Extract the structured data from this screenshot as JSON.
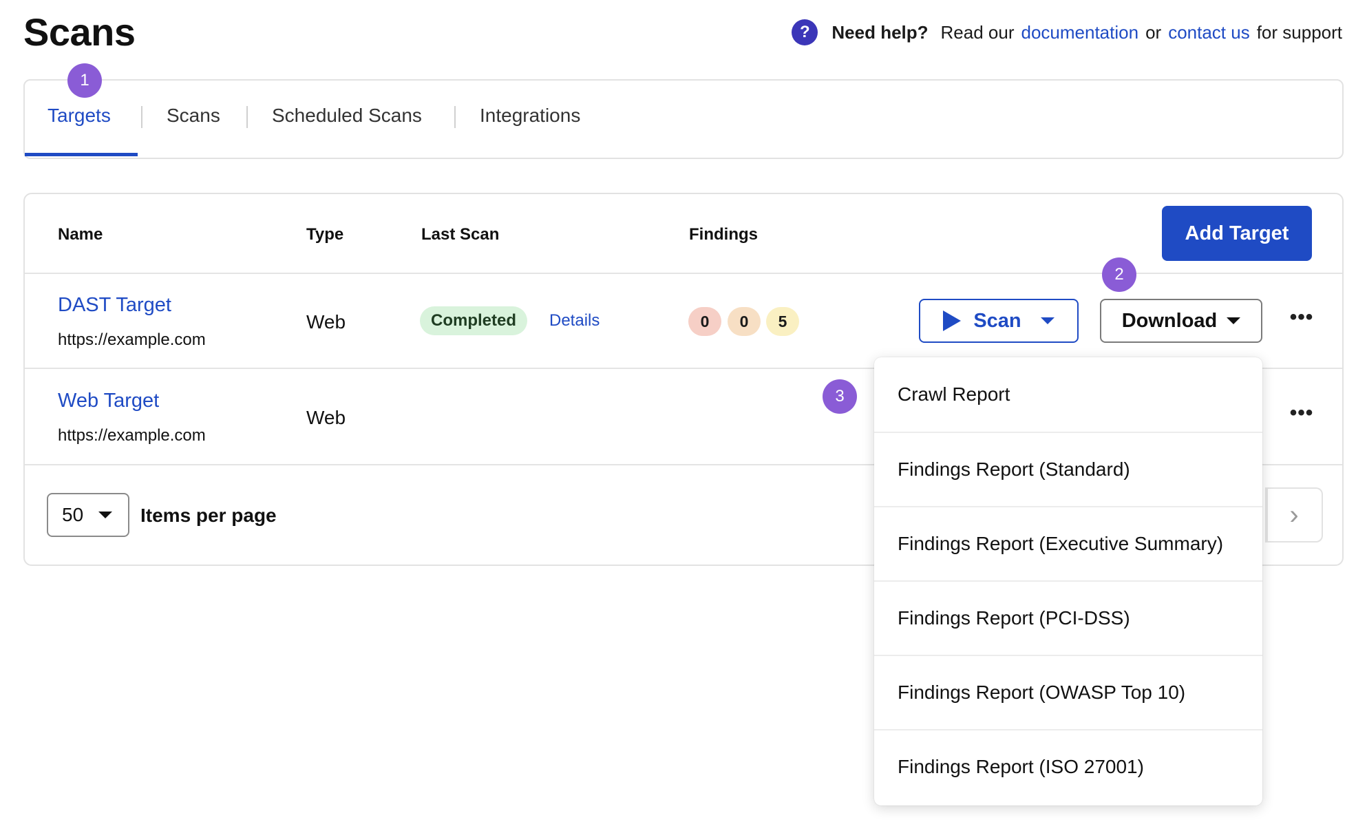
{
  "header": {
    "title": "Scans",
    "help_icon": "?",
    "help_strong": "Need help?",
    "help_text_1": "Read our",
    "help_link_docs": "documentation",
    "help_text_2": "or",
    "help_link_contact": "contact us",
    "help_text_3": "for support"
  },
  "tabs": [
    {
      "label": "Targets",
      "active": true
    },
    {
      "label": "Scans",
      "active": false
    },
    {
      "label": "Scheduled Scans",
      "active": false
    },
    {
      "label": "Integrations",
      "active": false
    }
  ],
  "steps": [
    "1",
    "2",
    "3"
  ],
  "table": {
    "columns": {
      "name": "Name",
      "type": "Type",
      "last_scan": "Last Scan",
      "findings": "Findings"
    },
    "add_button": "Add Target",
    "rows": [
      {
        "name": "DAST Target",
        "url": "https://example.com",
        "type": "Web",
        "status": "Completed",
        "details": "Details",
        "findings": [
          "0",
          "0",
          "5"
        ],
        "scan_button": "Scan",
        "download_button": "Download",
        "more": "•••"
      },
      {
        "name": "Web Target",
        "url": "https://example.com",
        "type": "Web",
        "more": "•••"
      }
    ]
  },
  "pagination": {
    "per_page_value": "50",
    "per_page_label": "Items per page",
    "next_icon": "›"
  },
  "download_menu": [
    "Crawl Report",
    "Findings Report (Standard)",
    "Findings Report (Executive Summary)",
    "Findings Report (PCI-DSS)",
    "Findings Report (OWASP Top 10)",
    "Findings Report (ISO 27001)"
  ],
  "colors": {
    "primary": "#1f4bc4",
    "step_badge": "#8a5cd6",
    "help_icon": "#3b36b8",
    "status_completed_bg": "#d9f3dc",
    "finding_critical_bg": "#f6cfc6",
    "finding_high_bg": "#f7dfc4",
    "finding_medium_bg": "#faf0c2"
  }
}
